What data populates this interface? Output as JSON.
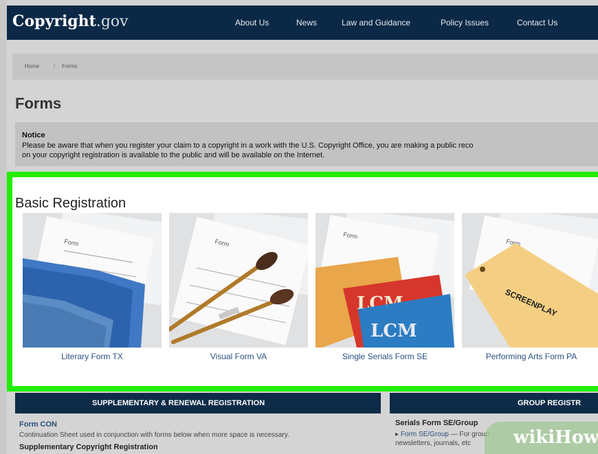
{
  "header": {
    "logo_main": "Copyright",
    "logo_suffix": ".gov",
    "nav": [
      "About Us",
      "News",
      "Law and Guidance",
      "Policy Issues",
      "Contact Us"
    ]
  },
  "breadcrumb": {
    "home": "Home",
    "separator": "/",
    "current": "Forms"
  },
  "page_title": "Forms",
  "notice": {
    "heading": "Notice",
    "line1": "Please be aware that when you register your claim to a copyright in a work with the U.S. Copyright Office, you are making a public reco",
    "line2": "on your copyright registration is available to the public and will be available on the Internet."
  },
  "basic_registration": {
    "heading": "Basic Registration",
    "cards": [
      {
        "label": "Literary Form TX",
        "image": "form-paper-with-blue-folders"
      },
      {
        "label": "Visual Form VA",
        "image": "form-paper-with-paintbrushes"
      },
      {
        "label": "Single Serials Form SE",
        "image": "form-paper-with-magazines",
        "magazine_text": [
          "LCM",
          "LCM"
        ]
      },
      {
        "label": "Performing Arts Form PA",
        "image": "form-paper-with-screenplay",
        "envelope_text": "SCREENPLAY"
      }
    ],
    "form_paper_text": "Form"
  },
  "supplementary": {
    "bar_title": "SUPPLEMENTARY & RENEWAL REGISTRATION",
    "item1_title": "Form CON",
    "item1_desc": "Continuation Sheet used in conjunction with forms below when more space is necessary.",
    "item2_title": "Supplementary Copyright Registration"
  },
  "group": {
    "bar_title": "GROUP REGISTR",
    "item1_title": "Serials Form SE/Group",
    "item1_link": "Form SE/Group",
    "item1_desc": " — For group",
    "item1_line2": "newsletters, journals, etc"
  },
  "watermark": "wikiHow",
  "colors": {
    "highlight": "#22ee00",
    "nav_bg": "#0b2946",
    "link": "#2a4f7e"
  }
}
